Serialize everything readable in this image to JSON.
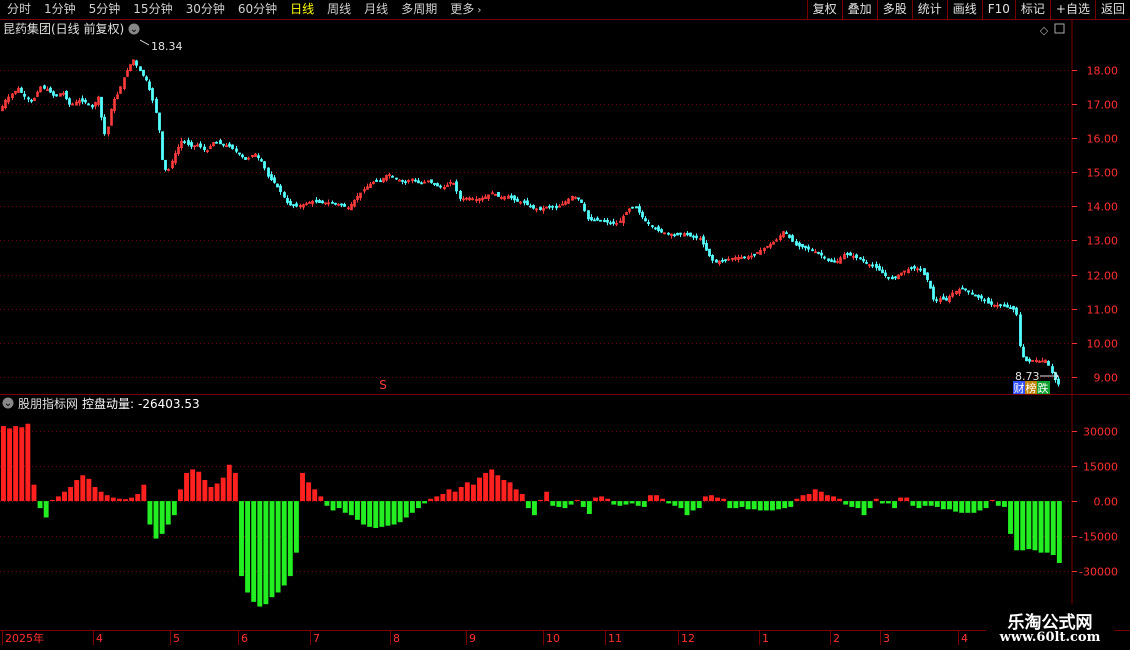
{
  "toolbar": {
    "left_items": [
      "分时",
      "1分钟",
      "5分钟",
      "15分钟",
      "30分钟",
      "60分钟",
      "日线",
      "周线",
      "月线",
      "多周期",
      "更多"
    ],
    "active_index": 6,
    "right_items": [
      "复权",
      "叠加",
      "多股",
      "统计",
      "画线",
      "F10",
      "标记",
      "+自选",
      "返回"
    ]
  },
  "price_panel": {
    "title": "昆药集团(日线 前复权)",
    "high_label": "18.34",
    "low_label": "8.73",
    "marker": "S",
    "badge_a": "财",
    "badge_b": "榜",
    "badge_c": "跌"
  },
  "indicator_panel": {
    "title": "股朋指标网",
    "indicator_name": "控盘动量:",
    "indicator_value": "-26403.53"
  },
  "colors": {
    "up": "#ff3c3c",
    "down": "#54ffff",
    "ind_up": "#ff2020",
    "ind_down": "#22ee22",
    "grid": "#7a0000",
    "axis_text": "#ff3030"
  },
  "chart_data": [
    {
      "type": "candlestick",
      "y_axis_labels": [
        "18.00",
        "17.00",
        "16.00",
        "15.00",
        "14.00",
        "13.00",
        "12.00",
        "11.00",
        "10.00",
        "9.00"
      ],
      "ylim": [
        8.5,
        18.9
      ],
      "close_path": [
        [
          0,
          16.8
        ],
        [
          5,
          17.1
        ],
        [
          12,
          17.3
        ],
        [
          18,
          17.45
        ],
        [
          25,
          17.2
        ],
        [
          32,
          17.05
        ],
        [
          40,
          17.5
        ],
        [
          48,
          17.4
        ],
        [
          55,
          17.2
        ],
        [
          62,
          17.35
        ],
        [
          70,
          16.95
        ],
        [
          78,
          17.1
        ],
        [
          86,
          17.05
        ],
        [
          92,
          16.9
        ],
        [
          98,
          17.2
        ],
        [
          104,
          16.1
        ],
        [
          108,
          16.35
        ],
        [
          112,
          17.05
        ],
        [
          118,
          17.3
        ],
        [
          124,
          17.8
        ],
        [
          128,
          18.05
        ],
        [
          133,
          18.3
        ],
        [
          140,
          17.95
        ],
        [
          146,
          17.7
        ],
        [
          150,
          17.35
        ],
        [
          154,
          16.95
        ],
        [
          158,
          16.45
        ],
        [
          163,
          15.1
        ],
        [
          168,
          15.05
        ],
        [
          174,
          15.5
        ],
        [
          182,
          15.95
        ],
        [
          190,
          15.75
        ],
        [
          198,
          15.8
        ],
        [
          206,
          15.6
        ],
        [
          214,
          15.9
        ],
        [
          222,
          15.8
        ],
        [
          230,
          15.75
        ],
        [
          238,
          15.55
        ],
        [
          246,
          15.35
        ],
        [
          254,
          15.55
        ],
        [
          262,
          15.3
        ],
        [
          268,
          14.85
        ],
        [
          274,
          14.7
        ],
        [
          280,
          14.45
        ],
        [
          288,
          14.05
        ],
        [
          296,
          14.0
        ],
        [
          304,
          14.05
        ],
        [
          312,
          14.15
        ],
        [
          320,
          14.1
        ],
        [
          330,
          14.1
        ],
        [
          340,
          14.05
        ],
        [
          348,
          13.95
        ],
        [
          356,
          14.25
        ],
        [
          364,
          14.5
        ],
        [
          372,
          14.7
        ],
        [
          380,
          14.75
        ],
        [
          388,
          14.95
        ],
        [
          396,
          14.8
        ],
        [
          404,
          14.7
        ],
        [
          412,
          14.8
        ],
        [
          420,
          14.65
        ],
        [
          428,
          14.75
        ],
        [
          436,
          14.6
        ],
        [
          444,
          14.55
        ],
        [
          452,
          14.75
        ],
        [
          460,
          14.2
        ],
        [
          468,
          14.25
        ],
        [
          476,
          14.2
        ],
        [
          484,
          14.25
        ],
        [
          492,
          14.4
        ],
        [
          500,
          14.25
        ],
        [
          508,
          14.3
        ],
        [
          516,
          14.15
        ],
        [
          524,
          14.1
        ],
        [
          532,
          13.95
        ],
        [
          540,
          13.9
        ],
        [
          548,
          14.0
        ],
        [
          556,
          13.95
        ],
        [
          564,
          14.1
        ],
        [
          572,
          14.3
        ],
        [
          580,
          14.2
        ],
        [
          588,
          13.6
        ],
        [
          596,
          13.6
        ],
        [
          604,
          13.55
        ],
        [
          612,
          13.5
        ],
        [
          618,
          13.5
        ],
        [
          624,
          13.75
        ],
        [
          630,
          13.95
        ],
        [
          636,
          13.95
        ],
        [
          644,
          13.6
        ],
        [
          652,
          13.4
        ],
        [
          660,
          13.25
        ],
        [
          668,
          13.2
        ],
        [
          676,
          13.15
        ],
        [
          684,
          13.2
        ],
        [
          692,
          13.1
        ],
        [
          700,
          13.05
        ],
        [
          708,
          12.6
        ],
        [
          714,
          12.35
        ],
        [
          720,
          12.4
        ],
        [
          728,
          12.45
        ],
        [
          736,
          12.5
        ],
        [
          744,
          12.5
        ],
        [
          752,
          12.55
        ],
        [
          760,
          12.7
        ],
        [
          768,
          12.85
        ],
        [
          776,
          13.0
        ],
        [
          784,
          13.3
        ],
        [
          790,
          13.05
        ],
        [
          796,
          12.85
        ],
        [
          804,
          12.8
        ],
        [
          812,
          12.7
        ],
        [
          820,
          12.6
        ],
        [
          828,
          12.4
        ],
        [
          836,
          12.35
        ],
        [
          844,
          12.6
        ],
        [
          852,
          12.55
        ],
        [
          860,
          12.45
        ],
        [
          868,
          12.3
        ],
        [
          876,
          12.2
        ],
        [
          884,
          12.0
        ],
        [
          890,
          11.85
        ],
        [
          896,
          11.95
        ],
        [
          904,
          12.1
        ],
        [
          912,
          12.2
        ],
        [
          920,
          12.15
        ],
        [
          928,
          11.8
        ],
        [
          934,
          11.2
        ],
        [
          940,
          11.3
        ],
        [
          946,
          11.25
        ],
        [
          952,
          11.45
        ],
        [
          958,
          11.55
        ],
        [
          964,
          11.6
        ],
        [
          970,
          11.45
        ],
        [
          976,
          11.35
        ],
        [
          982,
          11.3
        ],
        [
          988,
          11.15
        ],
        [
          994,
          11.1
        ],
        [
          1000,
          11.1
        ],
        [
          1006,
          11.05
        ],
        [
          1012,
          11.0
        ],
        [
          1016,
          10.95
        ],
        [
          1020,
          9.8
        ],
        [
          1024,
          9.5
        ],
        [
          1028,
          9.45
        ],
        [
          1034,
          9.5
        ],
        [
          1040,
          9.45
        ],
        [
          1046,
          9.5
        ],
        [
          1052,
          9.1
        ],
        [
          1056,
          8.85
        ],
        [
          1060,
          8.73
        ]
      ]
    },
    {
      "type": "bar",
      "y_axis_labels": [
        "30000",
        "15000",
        "0.00",
        "-15000",
        "-30000"
      ],
      "ylim": [
        -55000,
        38000
      ],
      "values": [
        32000,
        31000,
        32000,
        31500,
        33000,
        7000,
        -3000,
        -7000,
        500,
        2000,
        4000,
        6000,
        9000,
        11000,
        9500,
        6000,
        4000,
        2500,
        1500,
        1000,
        800,
        1500,
        3000,
        7000,
        -10000,
        -16000,
        -14000,
        -10000,
        -6000,
        5000,
        12000,
        13500,
        12500,
        9000,
        6000,
        7500,
        10000,
        15500,
        12000,
        -32000,
        -39000,
        -43000,
        -45000,
        -44000,
        -41000,
        -39000,
        -36000,
        -32000,
        -22000,
        12000,
        8000,
        5000,
        2000,
        -2000,
        -4000,
        -3000,
        -5000,
        -6000,
        -8000,
        -10000,
        -11000,
        -11500,
        -11000,
        -10500,
        -10000,
        -9000,
        -7000,
        -5000,
        -3000,
        -1000,
        1000,
        2000,
        3000,
        5000,
        4000,
        6000,
        8000,
        7000,
        10000,
        12000,
        13500,
        11000,
        9000,
        8000,
        5000,
        3000,
        -3000,
        -6000,
        500,
        4000,
        -2000,
        -2500,
        -3000,
        -1500,
        500,
        -2500,
        -5500,
        1500,
        2000,
        1000,
        -1500,
        -2000,
        -1500,
        -1000,
        -2000,
        -2500,
        2500,
        2500,
        1000,
        -1000,
        -2000,
        -3000,
        -6000,
        -4000,
        -3000,
        2000,
        2500,
        1500,
        1000,
        -3000,
        -3000,
        -2500,
        -3500,
        -3500,
        -4000,
        -4000,
        -4000,
        -3500,
        -3000,
        -2500,
        1000,
        2500,
        3000,
        5000,
        4000,
        2500,
        2000,
        1000,
        -1500,
        -2500,
        -3000,
        -6000,
        -3000,
        1000,
        -1000,
        -1000,
        -3000,
        1500,
        1500,
        -2000,
        -3000,
        -2000,
        -2000,
        -2500,
        -3500,
        -3500,
        -4500,
        -5000,
        -5000,
        -5000,
        -4000,
        -3000,
        500,
        -2000,
        -2500,
        -14000,
        -21000,
        -21000,
        -20500,
        -21000,
        -22000,
        -22000,
        -23000,
        -26403.53
      ]
    }
  ],
  "x_axis_labels": [
    "2025年",
    "4",
    "5",
    "6",
    "7",
    "8",
    "9",
    "10",
    "11",
    "12",
    "1",
    "2",
    "3",
    "4"
  ],
  "watermark": {
    "line1": "乐淘公式网",
    "line2": "www.60lt.com"
  }
}
